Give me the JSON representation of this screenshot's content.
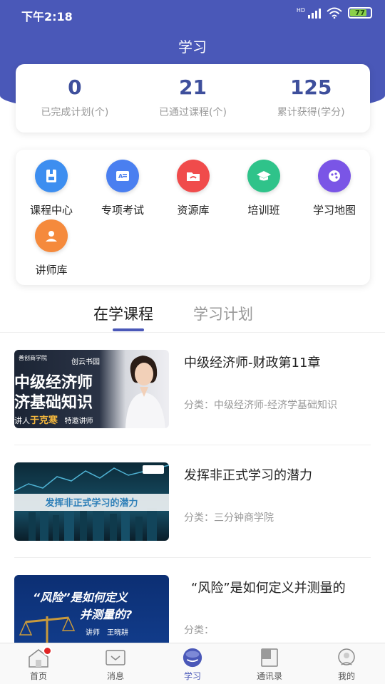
{
  "status_bar": {
    "time": "下午2:18",
    "network": "HD",
    "battery": "77"
  },
  "header": {
    "title": "学习"
  },
  "stats": [
    {
      "value": "0",
      "label": "已完成计划(个)"
    },
    {
      "value": "21",
      "label": "已通过课程(个)"
    },
    {
      "value": "125",
      "label": "累计获得(学分)"
    }
  ],
  "menu": [
    {
      "label": "课程中心",
      "icon": "book-icon",
      "color": "#3d8ef0"
    },
    {
      "label": "专项考试",
      "icon": "exam-icon",
      "color": "#4a7ff0"
    },
    {
      "label": "资源库",
      "icon": "folder-icon",
      "color": "#f04b4b"
    },
    {
      "label": "培训班",
      "icon": "graduation-cap-icon",
      "color": "#2fc38a"
    },
    {
      "label": "学习地图",
      "icon": "map-icon",
      "color": "#7a55e6"
    },
    {
      "label": "讲师库",
      "icon": "teacher-icon",
      "color": "#f58a3c"
    }
  ],
  "tabs": {
    "active": "在学课程",
    "inactive": "学习计划"
  },
  "courses": [
    {
      "title": "中级经济师-财政第11章",
      "category": "分类：中级经济师-经济学基础知识",
      "thumb": {
        "brand_left": "善创商学院",
        "brand_right": "创云书园",
        "line1": "中级经济师",
        "line2": "济基础知识",
        "speaker_prefix": "讲人",
        "speaker": "于克寒",
        "badge": "特邀讲师"
      }
    },
    {
      "title": "发挥非正式学习的潜力",
      "category": "分类：三分钟商学院",
      "thumb": {
        "caption": "发挥非正式学习的潜力"
      }
    },
    {
      "title": "“风险”是如何定义并测量的",
      "category": "分类：",
      "thumb": {
        "line1": "“风险”是如何定义",
        "line2": "并测量的?",
        "speaker": "讲师　王晓耕"
      }
    }
  ],
  "tabbar": [
    {
      "label": "首页",
      "icon": "home-icon"
    },
    {
      "label": "消息",
      "icon": "message-icon"
    },
    {
      "label": "学习",
      "icon": "study-icon"
    },
    {
      "label": "通讯录",
      "icon": "contacts-icon"
    },
    {
      "label": "我的",
      "icon": "profile-icon"
    }
  ]
}
